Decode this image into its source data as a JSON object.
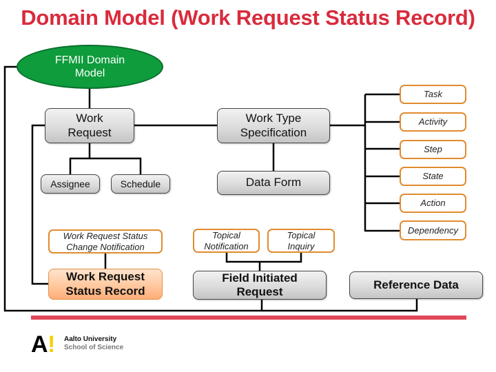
{
  "slide": {
    "title": "Domain Model (Work Request Status Record)"
  },
  "diagram": {
    "root": "FFMII Domain Model",
    "work_request": "Work Request",
    "assignee": "Assignee",
    "schedule": "Schedule",
    "work_type_specification": "Work Type Specification",
    "data_form": "Data Form",
    "spec_children": [
      "Task",
      "Activity",
      "Step",
      "State",
      "Action",
      "Dependency"
    ],
    "status_change_notification": "Work Request Status Change Notification",
    "status_record": "Work Request Status Record",
    "topical_notification": "Topical Notification",
    "topical_inquiry": "Topical Inquiry",
    "field_initiated_request": "Field Initiated Request",
    "reference_data": "Reference Data"
  },
  "colors": {
    "title": "#d92b3c",
    "root_fill": "#0e9c3c",
    "orange_border": "#e08a2e",
    "record_fill": "#ffc9a0",
    "accent_bar": "#e0475a"
  },
  "footer": {
    "logo_mark": "A",
    "logo_exclaim": "!",
    "university": "Aalto University",
    "school": "School of Science"
  }
}
